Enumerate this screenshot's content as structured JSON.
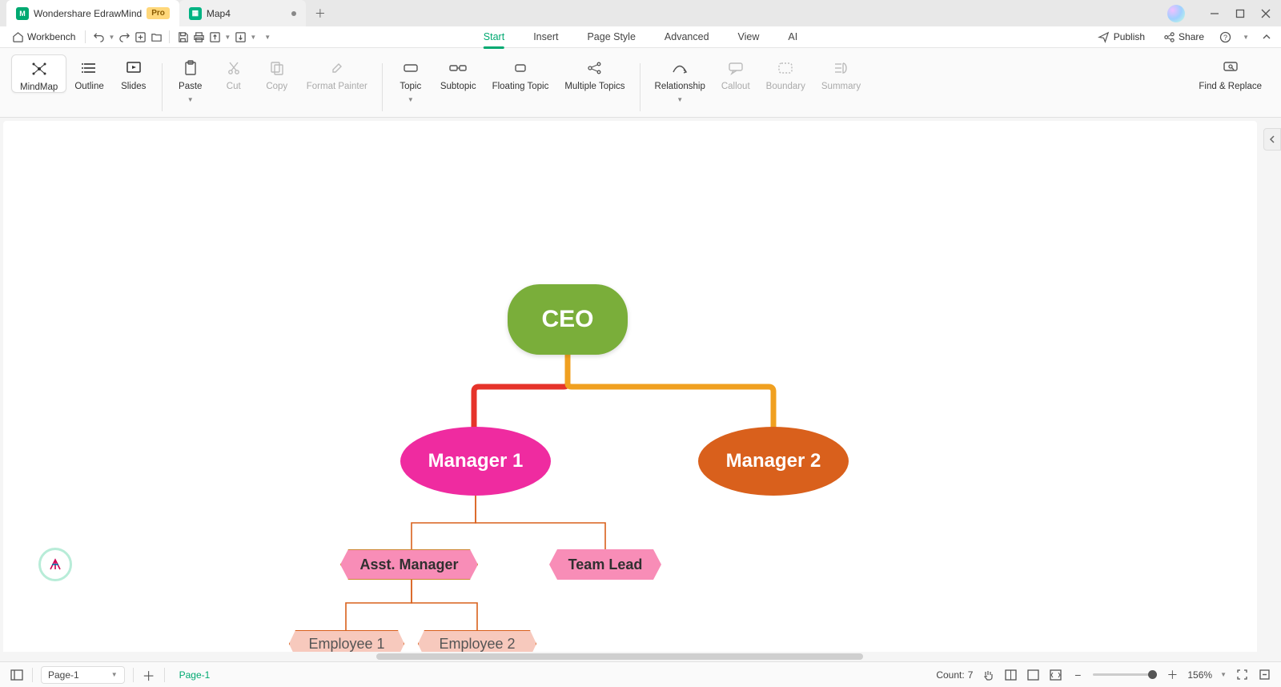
{
  "title": {
    "app": "Wondershare EdrawMind",
    "badge": "Pro",
    "doc": "Map4"
  },
  "quickbar": {
    "workbench": "Workbench"
  },
  "menus": [
    "Start",
    "Insert",
    "Page Style",
    "Advanced",
    "View",
    "AI"
  ],
  "topright": {
    "publish": "Publish",
    "share": "Share"
  },
  "views": {
    "mindmap": "MindMap",
    "outline": "Outline",
    "slides": "Slides"
  },
  "ribbon": {
    "paste": "Paste",
    "cut": "Cut",
    "copy": "Copy",
    "fmt": "Format Painter",
    "topic": "Topic",
    "subtopic": "Subtopic",
    "floating": "Floating Topic",
    "multiple": "Multiple Topics",
    "relationship": "Relationship",
    "callout": "Callout",
    "boundary": "Boundary",
    "summary": "Summary",
    "find": "Find & Replace"
  },
  "nodes": {
    "ceo": "CEO",
    "mgr1": "Manager 1",
    "mgr2": "Manager 2",
    "asst": "Asst. Manager",
    "lead": "Team Lead",
    "emp1": "Employee 1",
    "emp2": "Employee 2"
  },
  "status": {
    "pagesel": "Page-1",
    "pagetab": "Page-1",
    "count_label": "Count:",
    "count": "7",
    "zoom": "156%"
  },
  "chart_data": {
    "type": "org-chart",
    "root": {
      "label": "CEO",
      "color": "#7aae3a",
      "children": [
        {
          "label": "Manager 1",
          "color": "#ef2ba0",
          "children": [
            {
              "label": "Asst. Manager",
              "color": "#f88db7",
              "children": [
                {
                  "label": "Employee 1",
                  "color": "#f7c9bd"
                },
                {
                  "label": "Employee 2",
                  "color": "#f7c9bd"
                }
              ]
            },
            {
              "label": "Team Lead",
              "color": "#f88db7"
            }
          ]
        },
        {
          "label": "Manager 2",
          "color": "#d9601c"
        }
      ]
    }
  }
}
